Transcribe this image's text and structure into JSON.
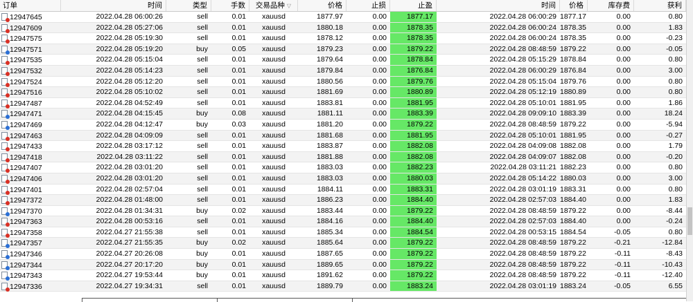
{
  "columns": {
    "order": "订单",
    "time": "时间",
    "type": "类型",
    "lots": "手数",
    "symbol": "交易品种",
    "price": "价格",
    "sl": "止损",
    "tp": "止盈",
    "close_time": "时间",
    "close_price": "价格",
    "swap": "库存费",
    "profit": "获利"
  },
  "sort_indicator": "▽",
  "colors": {
    "tp_highlight": "#66e866",
    "sell_icon": "#d93025",
    "buy_icon": "#2a6fd6"
  },
  "rows": [
    {
      "order": "12947645",
      "time": "2022.04.28 06:00:26",
      "type": "sell",
      "lots": "0.01",
      "symbol": "xauusd",
      "price": "1877.97",
      "sl": "0.00",
      "tp": "1877.17",
      "close_time": "2022.04.28 06:00:29",
      "close_price": "1877.17",
      "swap": "0.00",
      "profit": "0.80"
    },
    {
      "order": "12947609",
      "time": "2022.04.28 05:27:06",
      "type": "sell",
      "lots": "0.01",
      "symbol": "xauusd",
      "price": "1880.18",
      "sl": "0.00",
      "tp": "1878.35",
      "close_time": "2022.04.28 06:00:24",
      "close_price": "1878.35",
      "swap": "0.00",
      "profit": "1.83"
    },
    {
      "order": "12947575",
      "time": "2022.04.28 05:19:30",
      "type": "sell",
      "lots": "0.01",
      "symbol": "xauusd",
      "price": "1878.12",
      "sl": "0.00",
      "tp": "1878.35",
      "close_time": "2022.04.28 06:00:24",
      "close_price": "1878.35",
      "swap": "0.00",
      "profit": "-0.23"
    },
    {
      "order": "12947571",
      "time": "2022.04.28 05:19:20",
      "type": "buy",
      "lots": "0.05",
      "symbol": "xauusd",
      "price": "1879.23",
      "sl": "0.00",
      "tp": "1879.22",
      "close_time": "2022.04.28 08:48:59",
      "close_price": "1879.22",
      "swap": "0.00",
      "profit": "-0.05"
    },
    {
      "order": "12947535",
      "time": "2022.04.28 05:15:04",
      "type": "sell",
      "lots": "0.01",
      "symbol": "xauusd",
      "price": "1879.64",
      "sl": "0.00",
      "tp": "1878.84",
      "close_time": "2022.04.28 05:15:29",
      "close_price": "1878.84",
      "swap": "0.00",
      "profit": "0.80"
    },
    {
      "order": "12947532",
      "time": "2022.04.28 05:14:23",
      "type": "sell",
      "lots": "0.01",
      "symbol": "xauusd",
      "price": "1879.84",
      "sl": "0.00",
      "tp": "1876.84",
      "close_time": "2022.04.28 06:00:29",
      "close_price": "1876.84",
      "swap": "0.00",
      "profit": "3.00"
    },
    {
      "order": "12947524",
      "time": "2022.04.28 05:12:20",
      "type": "sell",
      "lots": "0.01",
      "symbol": "xauusd",
      "price": "1880.56",
      "sl": "0.00",
      "tp": "1879.76",
      "close_time": "2022.04.28 05:15:04",
      "close_price": "1879.76",
      "swap": "0.00",
      "profit": "0.80"
    },
    {
      "order": "12947516",
      "time": "2022.04.28 05:10:02",
      "type": "sell",
      "lots": "0.01",
      "symbol": "xauusd",
      "price": "1881.69",
      "sl": "0.00",
      "tp": "1880.89",
      "close_time": "2022.04.28 05:12:19",
      "close_price": "1880.89",
      "swap": "0.00",
      "profit": "0.80"
    },
    {
      "order": "12947487",
      "time": "2022.04.28 04:52:49",
      "type": "sell",
      "lots": "0.01",
      "symbol": "xauusd",
      "price": "1883.81",
      "sl": "0.00",
      "tp": "1881.95",
      "close_time": "2022.04.28 05:10:01",
      "close_price": "1881.95",
      "swap": "0.00",
      "profit": "1.86"
    },
    {
      "order": "12947471",
      "time": "2022.04.28 04:15:45",
      "type": "buy",
      "lots": "0.08",
      "symbol": "xauusd",
      "price": "1881.11",
      "sl": "0.00",
      "tp": "1883.39",
      "close_time": "2022.04.28 09:09:10",
      "close_price": "1883.39",
      "swap": "0.00",
      "profit": "18.24"
    },
    {
      "order": "12947469",
      "time": "2022.04.28 04:12:47",
      "type": "buy",
      "lots": "0.03",
      "symbol": "xauusd",
      "price": "1881.20",
      "sl": "0.00",
      "tp": "1879.22",
      "close_time": "2022.04.28 08:48:59",
      "close_price": "1879.22",
      "swap": "0.00",
      "profit": "-5.94"
    },
    {
      "order": "12947463",
      "time": "2022.04.28 04:09:09",
      "type": "sell",
      "lots": "0.01",
      "symbol": "xauusd",
      "price": "1881.68",
      "sl": "0.00",
      "tp": "1881.95",
      "close_time": "2022.04.28 05:10:01",
      "close_price": "1881.95",
      "swap": "0.00",
      "profit": "-0.27"
    },
    {
      "order": "12947433",
      "time": "2022.04.28 03:17:12",
      "type": "sell",
      "lots": "0.01",
      "symbol": "xauusd",
      "price": "1883.87",
      "sl": "0.00",
      "tp": "1882.08",
      "close_time": "2022.04.28 04:09:08",
      "close_price": "1882.08",
      "swap": "0.00",
      "profit": "1.79"
    },
    {
      "order": "12947418",
      "time": "2022.04.28 03:11:22",
      "type": "sell",
      "lots": "0.01",
      "symbol": "xauusd",
      "price": "1881.88",
      "sl": "0.00",
      "tp": "1882.08",
      "close_time": "2022.04.28 04:09:07",
      "close_price": "1882.08",
      "swap": "0.00",
      "profit": "-0.20"
    },
    {
      "order": "12947407",
      "time": "2022.04.28 03:01:20",
      "type": "sell",
      "lots": "0.01",
      "symbol": "xauusd",
      "price": "1883.03",
      "sl": "0.00",
      "tp": "1882.23",
      "close_time": "2022.04.28 03:11:21",
      "close_price": "1882.23",
      "swap": "0.00",
      "profit": "0.80"
    },
    {
      "order": "12947406",
      "time": "2022.04.28 03:01:20",
      "type": "sell",
      "lots": "0.01",
      "symbol": "xauusd",
      "price": "1883.03",
      "sl": "0.00",
      "tp": "1880.03",
      "close_time": "2022.04.28 05:14:22",
      "close_price": "1880.03",
      "swap": "0.00",
      "profit": "3.00"
    },
    {
      "order": "12947401",
      "time": "2022.04.28 02:57:04",
      "type": "sell",
      "lots": "0.01",
      "symbol": "xauusd",
      "price": "1884.11",
      "sl": "0.00",
      "tp": "1883.31",
      "close_time": "2022.04.28 03:01:19",
      "close_price": "1883.31",
      "swap": "0.00",
      "profit": "0.80"
    },
    {
      "order": "12947372",
      "time": "2022.04.28 01:48:00",
      "type": "sell",
      "lots": "0.01",
      "symbol": "xauusd",
      "price": "1886.23",
      "sl": "0.00",
      "tp": "1884.40",
      "close_time": "2022.04.28 02:57:03",
      "close_price": "1884.40",
      "swap": "0.00",
      "profit": "1.83"
    },
    {
      "order": "12947370",
      "time": "2022.04.28 01:34:31",
      "type": "buy",
      "lots": "0.02",
      "symbol": "xauusd",
      "price": "1883.44",
      "sl": "0.00",
      "tp": "1879.22",
      "close_time": "2022.04.28 08:48:59",
      "close_price": "1879.22",
      "swap": "0.00",
      "profit": "-8.44"
    },
    {
      "order": "12947363",
      "time": "2022.04.28 00:53:16",
      "type": "sell",
      "lots": "0.01",
      "symbol": "xauusd",
      "price": "1884.16",
      "sl": "0.00",
      "tp": "1884.40",
      "close_time": "2022.04.28 02:57:03",
      "close_price": "1884.40",
      "swap": "0.00",
      "profit": "-0.24"
    },
    {
      "order": "12947358",
      "time": "2022.04.27 21:55:38",
      "type": "sell",
      "lots": "0.01",
      "symbol": "xauusd",
      "price": "1885.34",
      "sl": "0.00",
      "tp": "1884.54",
      "close_time": "2022.04.28 00:53:15",
      "close_price": "1884.54",
      "swap": "-0.05",
      "profit": "0.80"
    },
    {
      "order": "12947357",
      "time": "2022.04.27 21:55:35",
      "type": "buy",
      "lots": "0.02",
      "symbol": "xauusd",
      "price": "1885.64",
      "sl": "0.00",
      "tp": "1879.22",
      "close_time": "2022.04.28 08:48:59",
      "close_price": "1879.22",
      "swap": "-0.21",
      "profit": "-12.84"
    },
    {
      "order": "12947346",
      "time": "2022.04.27 20:26:08",
      "type": "buy",
      "lots": "0.01",
      "symbol": "xauusd",
      "price": "1887.65",
      "sl": "0.00",
      "tp": "1879.22",
      "close_time": "2022.04.28 08:48:59",
      "close_price": "1879.22",
      "swap": "-0.11",
      "profit": "-8.43"
    },
    {
      "order": "12947344",
      "time": "2022.04.27 20:17:20",
      "type": "buy",
      "lots": "0.01",
      "symbol": "xauusd",
      "price": "1889.65",
      "sl": "0.00",
      "tp": "1879.22",
      "close_time": "2022.04.28 08:48:59",
      "close_price": "1879.22",
      "swap": "-0.11",
      "profit": "-10.43"
    },
    {
      "order": "12947343",
      "time": "2022.04.27 19:53:44",
      "type": "buy",
      "lots": "0.01",
      "symbol": "xauusd",
      "price": "1891.62",
      "sl": "0.00",
      "tp": "1879.22",
      "close_time": "2022.04.28 08:48:59",
      "close_price": "1879.22",
      "swap": "-0.11",
      "profit": "-12.40"
    },
    {
      "order": "12947336",
      "time": "2022.04.27 19:34:31",
      "type": "sell",
      "lots": "0.01",
      "symbol": "xauusd",
      "price": "1889.79",
      "sl": "0.00",
      "tp": "1883.24",
      "close_time": "2022.04.28 03:01:19",
      "close_price": "1883.24",
      "swap": "-0.05",
      "profit": "6.55"
    }
  ]
}
